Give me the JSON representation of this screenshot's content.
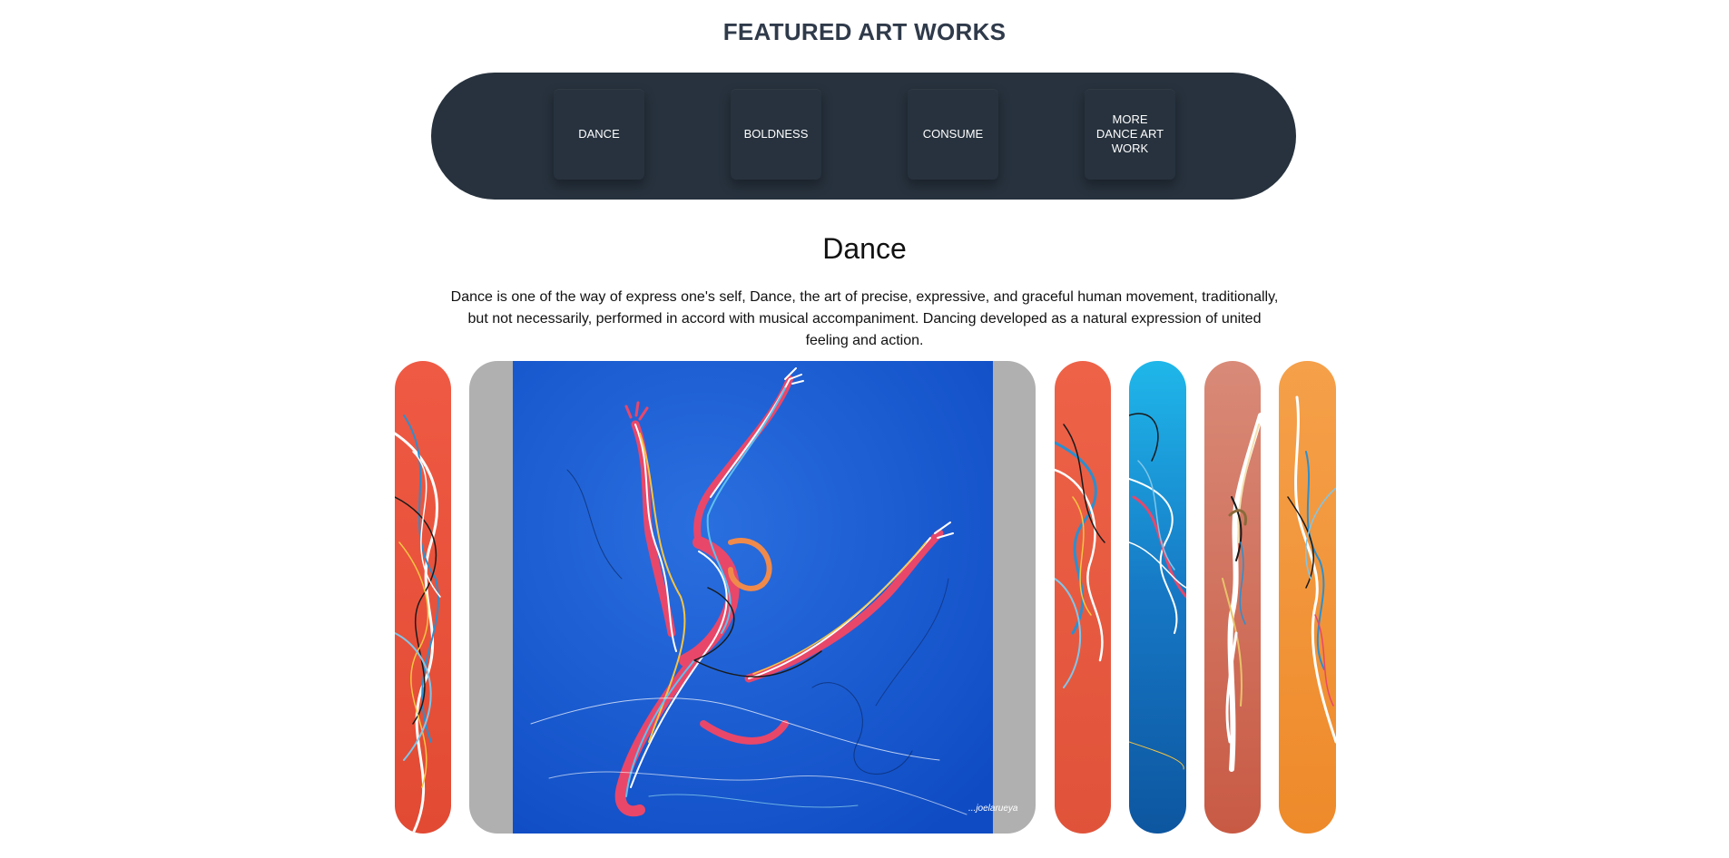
{
  "header": {
    "title": "FEATURED ART WORKS"
  },
  "nav": {
    "items": [
      {
        "label": "DANCE"
      },
      {
        "label": "BOLDNESS"
      },
      {
        "label": "CONSUME"
      },
      {
        "label": "MORE DANCE ART WORK"
      }
    ]
  },
  "section": {
    "title": "Dance",
    "description": "Dance is one of the way of express one's self, Dance, the art of precise, expressive, and graceful human movement, traditionally, but not necessarily, performed in accord with musical accompaniment. Dancing developed as a natural expression of united feeling and action."
  },
  "gallery": {
    "active_index": 1,
    "signature": "...joelarueya",
    "cards": [
      {
        "name": "dance-artwork-red",
        "background": "#e8553f"
      },
      {
        "name": "dance-artwork-blue-main",
        "background": "#1b5fd6"
      },
      {
        "name": "dance-artwork-coral",
        "background": "#e65a40"
      },
      {
        "name": "dance-artwork-cyan",
        "background": "#1a8fd2"
      },
      {
        "name": "dance-artwork-terracotta",
        "background": "#c9654f"
      },
      {
        "name": "dance-artwork-orange",
        "background": "#f0902e"
      }
    ]
  },
  "colors": {
    "nav_background": "#27323e",
    "title_color": "#2f3a4a"
  }
}
